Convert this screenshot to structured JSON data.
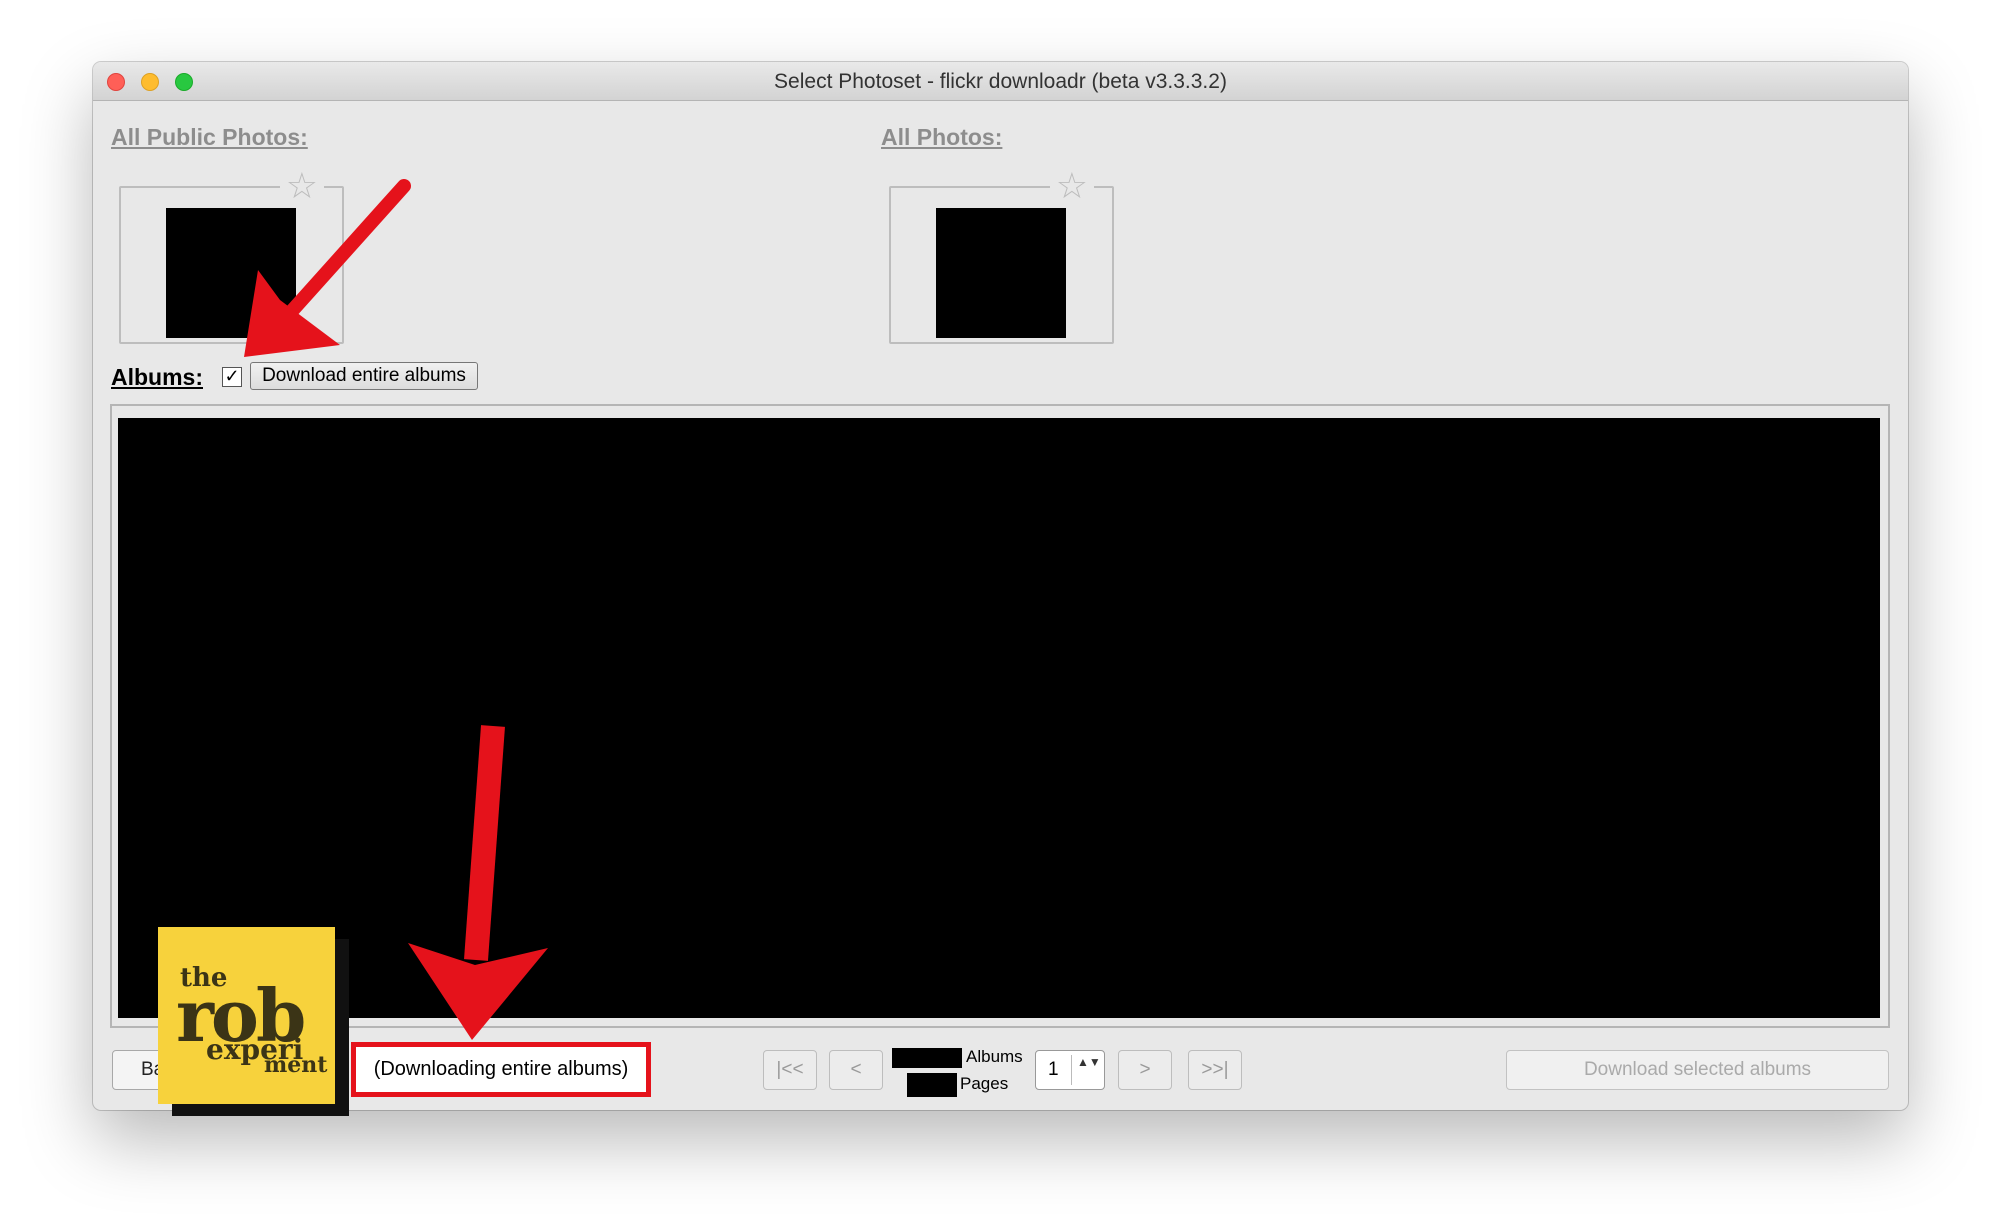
{
  "window": {
    "title": "Select Photoset - flickr downloadr (beta v3.3.3.2)",
    "controls": [
      "close",
      "minimize",
      "zoom"
    ]
  },
  "sections": {
    "public_label": "All Public Photos:",
    "all_label": "All Photos:",
    "star_icon": "☆"
  },
  "albums": {
    "label": "Albums:",
    "checkbox_checked": true,
    "checkbox_glyph": "✓",
    "download_entire_label": "Download entire albums"
  },
  "footer": {
    "back_label": "Ba",
    "status": "(Downloading entire albums)",
    "first_label": "|<<",
    "prev_label": "<",
    "next_label": ">",
    "last_label": ">>|",
    "albums_count_label": "Albums",
    "pages_count_label": "Pages",
    "page_number": "1",
    "stepper_glyph": "▲▼",
    "download_selected_label": "Download selected albums"
  },
  "annotations": {
    "arrow_color": "#e5121b",
    "highlight_color": "#e5121b"
  },
  "logo": {
    "line1": "the",
    "line2": "rob",
    "line3": "experi",
    "line4": "ment",
    "background": "#f7d23c"
  }
}
